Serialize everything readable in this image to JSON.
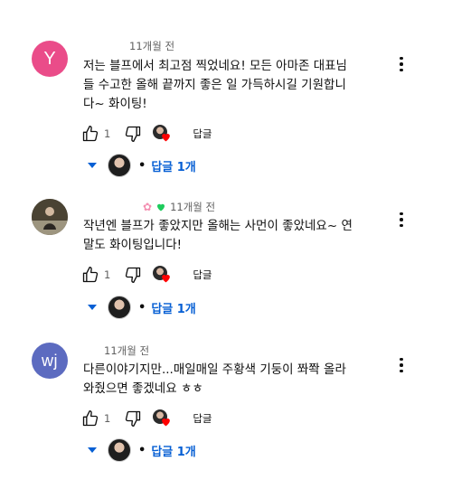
{
  "comments": [
    {
      "avatar_letter": "Y",
      "avatar_color": "#ea4c89",
      "time": "11개월 전",
      "text_lines": [
        "저는 블프에서 최고점 찍었네요! 모든 아마존 대표님",
        "들 수고한 올해 끝까지 좋은 일 가득하시길 기원합니",
        "다~ 화이팅!"
      ],
      "likes": "1",
      "reply_label": "답글",
      "replies_label": "답글 1개"
    },
    {
      "avatar_letter": "",
      "avatar_color": "photo",
      "time": "11개월 전",
      "badge_icons": [
        "pink-blossom-icon",
        "green-heart-icon"
      ],
      "text_lines": [
        "작년엔 블프가 좋았지만 올해는 사먼이 좋았네요~ 연",
        "말도 화이팅입니다!"
      ],
      "likes": "1",
      "reply_label": "답글",
      "replies_label": "답글 1개"
    },
    {
      "avatar_letter": "wj",
      "avatar_color": "#5c6bc0",
      "time": "11개월 전",
      "text_lines": [
        "다른이야기지만...매일매일 주황색 기둥이 쫘쫙 올라",
        "와줬으면 좋겠네요 ㅎㅎ"
      ],
      "likes": "1",
      "reply_label": "답글",
      "replies_label": "답글 1개"
    }
  ],
  "colors": {
    "link_blue": "#065fd4",
    "heart_red": "#ff0000",
    "meta_gray": "#606060"
  }
}
